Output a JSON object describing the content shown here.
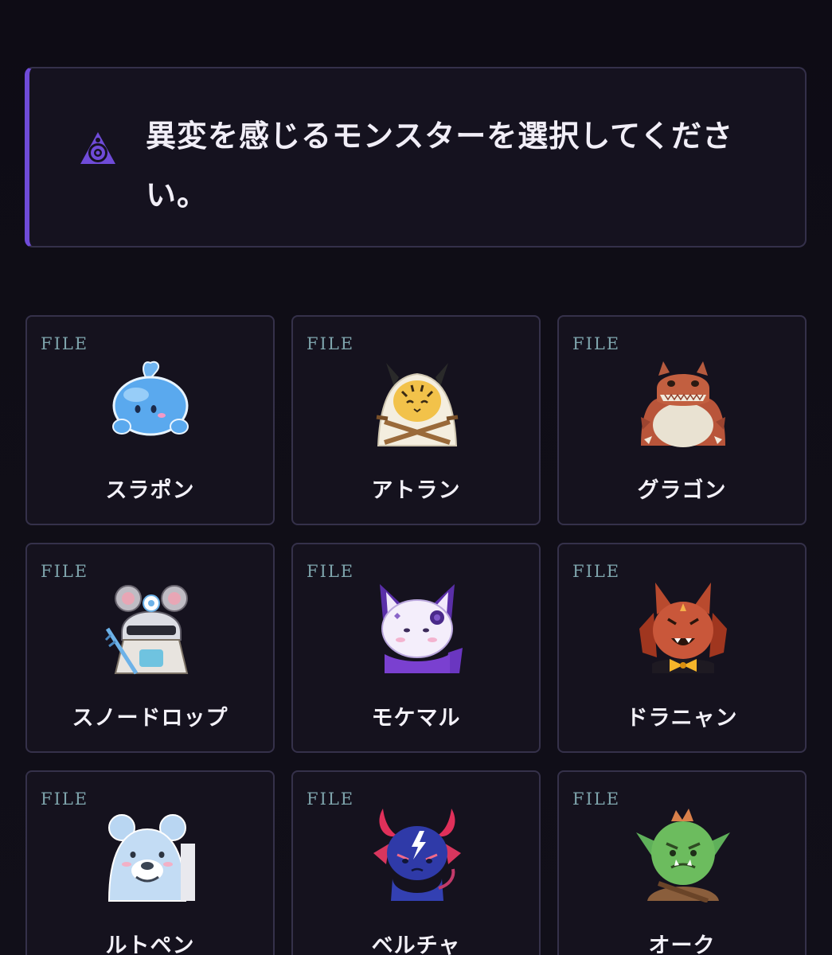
{
  "colors": {
    "background": "#0f0d16",
    "panel": "#15121f",
    "panel_border": "#34304a",
    "accent": "#6f4bd8",
    "file_tag": "#7fa5ad",
    "text": "#f1eef7"
  },
  "prompt": {
    "icon": "observer-eye-icon",
    "text": "異変を感じるモンスターを選択してください。"
  },
  "monsters": [
    {
      "tag": "FILE",
      "name": "スラポン",
      "icon": "slime-icon"
    },
    {
      "tag": "FILE",
      "name": "アトラン",
      "icon": "hooded-cat-icon"
    },
    {
      "tag": "FILE",
      "name": "グラゴン",
      "icon": "dragon-icon"
    },
    {
      "tag": "FILE",
      "name": "スノードロップ",
      "icon": "armored-mouse-knight-icon"
    },
    {
      "tag": "FILE",
      "name": "モケマル",
      "icon": "purple-fox-icon"
    },
    {
      "tag": "FILE",
      "name": "ドラニャン",
      "icon": "bat-cat-icon"
    },
    {
      "tag": "FILE",
      "name": "ルトペン",
      "icon": "bear-icon"
    },
    {
      "tag": "FILE",
      "name": "ベルチャ",
      "icon": "demon-icon"
    },
    {
      "tag": "FILE",
      "name": "オーク",
      "icon": "orc-icon"
    }
  ]
}
